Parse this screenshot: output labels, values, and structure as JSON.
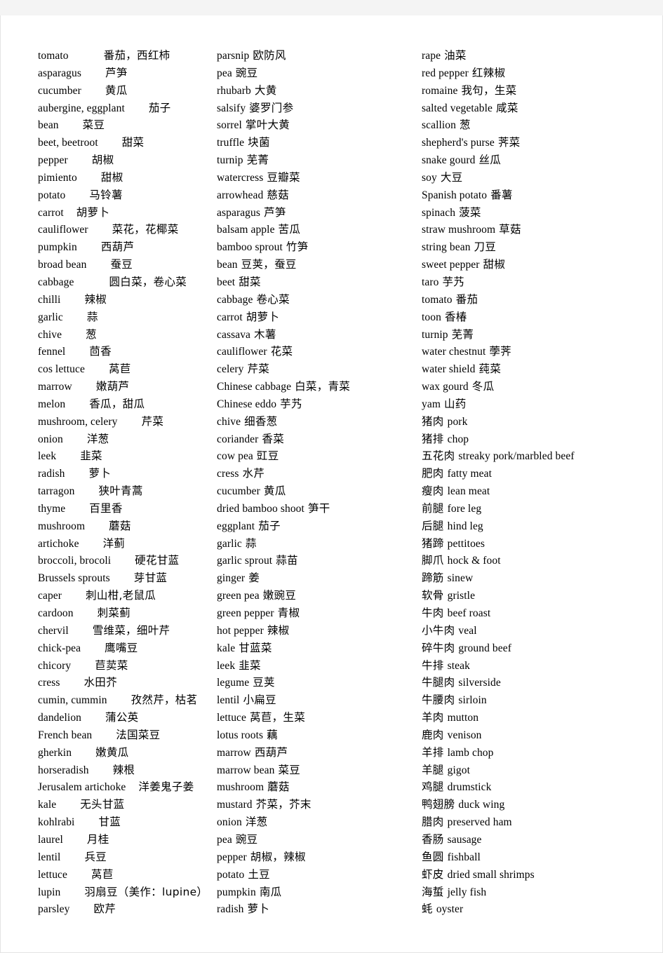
{
  "document": {
    "title": "English-Chinese Food Vocabulary List",
    "page_background": "#ffffff",
    "gutter_color": "#f4f4f4",
    "text_color": "#000000",
    "column_count": 3
  },
  "columns": [
    {
      "name": "column-1",
      "entries": [
        {
          "en": "tomato",
          "zh": "番茄，西红柿",
          "gap": "gap-l"
        },
        {
          "en": "asparagus",
          "zh": "芦笋",
          "gap": "gap-m"
        },
        {
          "en": "cucumber",
          "zh": "黄瓜",
          "gap": "gap-m"
        },
        {
          "en": "aubergine, eggplant",
          "zh": "茄子",
          "gap": "gap-m"
        },
        {
          "en": "bean",
          "zh": "菜豆",
          "gap": "gap-m"
        },
        {
          "en": "beet, beetroot",
          "zh": "甜菜",
          "gap": "gap-m"
        },
        {
          "en": "pepper",
          "zh": "胡椒",
          "gap": "gap-m"
        },
        {
          "en": "pimiento",
          "zh": "甜椒",
          "gap": "gap-m"
        },
        {
          "en": "potato",
          "zh": "马铃薯",
          "gap": "gap-m"
        },
        {
          "en": "carrot",
          "zh": "胡萝卜",
          "gap": "gap-s"
        },
        {
          "en": "cauliflower",
          "zh": "菜花，花椰菜",
          "gap": "gap-m"
        },
        {
          "en": "pumpkin",
          "zh": "西葫芦",
          "gap": "gap-m"
        },
        {
          "en": "broad bean",
          "zh": "蚕豆",
          "gap": "gap-m"
        },
        {
          "en": "cabbage",
          "zh": "圆白菜，卷心菜",
          "gap": "gap-l"
        },
        {
          "en": "chilli",
          "zh": "辣椒",
          "gap": "gap-m"
        },
        {
          "en": "garlic",
          "zh": "蒜",
          "gap": "gap-m"
        },
        {
          "en": "chive",
          "zh": "葱",
          "gap": "gap-m"
        },
        {
          "en": "fennel",
          "zh": "茴香",
          "gap": "gap-m"
        },
        {
          "en": "cos lettuce",
          "zh": "莴苣",
          "gap": "gap-m"
        },
        {
          "en": "marrow",
          "zh": "嫩葫芦",
          "gap": "gap-m"
        },
        {
          "en": "melon",
          "zh": "香瓜，甜瓜",
          "gap": "gap-m"
        },
        {
          "en": "mushroom, celery",
          "zh": "芹菜",
          "gap": "gap-m"
        },
        {
          "en": "onion",
          "zh": "洋葱",
          "gap": "gap-m"
        },
        {
          "en": "leek",
          "zh": "韭菜",
          "gap": "gap-m"
        },
        {
          "en": "radish",
          "zh": "萝卜",
          "gap": "gap-m"
        },
        {
          "en": "tarragon",
          "zh": "狭叶青蒿",
          "gap": "gap-m"
        },
        {
          "en": "thyme",
          "zh": "百里香",
          "gap": "gap-m"
        },
        {
          "en": "mushroom",
          "zh": "蘑菇",
          "gap": "gap-m"
        },
        {
          "en": "artichoke",
          "zh": "洋蓟",
          "gap": "gap-m"
        },
        {
          "en": "broccoli, brocoli",
          "zh": "硬花甘蓝",
          "gap": "gap-m"
        },
        {
          "en": "Brussels sprouts",
          "zh": "芽甘蓝",
          "gap": "gap-m"
        },
        {
          "en": "caper",
          "zh": "刺山柑,老鼠瓜",
          "gap": "gap-m"
        },
        {
          "en": "cardoon",
          "zh": "刺菜蓟",
          "gap": "gap-m"
        },
        {
          "en": "chervil",
          "zh": "雪维菜，细叶芹",
          "gap": "gap-m"
        },
        {
          "en": "chick-pea",
          "zh": "鹰嘴豆",
          "gap": "gap-m"
        },
        {
          "en": "chicory",
          "zh": "苣荬菜",
          "gap": "gap-m"
        },
        {
          "en": "cress",
          "zh": "水田芥",
          "gap": "gap-m"
        },
        {
          "en": "cumin, cummin",
          "zh": "孜然芹，枯茗",
          "gap": "gap-m"
        },
        {
          "en": "dandelion",
          "zh": "蒲公英",
          "gap": "gap-m"
        },
        {
          "en": "French bean",
          "zh": "法国菜豆",
          "gap": "gap-m"
        },
        {
          "en": "gherkin",
          "zh": "嫩黄瓜",
          "gap": "gap-m"
        },
        {
          "en": "horseradish",
          "zh": "辣根",
          "gap": "gap-m"
        },
        {
          "en": "Jerusalem artichoke",
          "zh": "洋姜鬼子姜",
          "gap": "gap-s"
        },
        {
          "en": "kale",
          "zh": "无头甘蓝",
          "gap": "gap-m"
        },
        {
          "en": "kohlrabi",
          "zh": "甘蓝",
          "gap": "gap-m"
        },
        {
          "en": "laurel",
          "zh": "月桂",
          "gap": "gap-m"
        },
        {
          "en": "lentil",
          "zh": "兵豆",
          "gap": "gap-m"
        },
        {
          "en": "lettuce",
          "zh": "莴苣",
          "gap": "gap-m"
        },
        {
          "en": "lupin",
          "zh": "羽扇豆（美作：lupine）",
          "gap": "gap-m"
        },
        {
          "en": "parsley",
          "zh": "欧芹",
          "gap": "gap-m"
        }
      ]
    },
    {
      "name": "column-2",
      "entries": [
        {
          "en": "parsnip",
          "zh": "欧防风",
          "gap": "gap-m"
        },
        {
          "en": "pea",
          "zh": "豌豆",
          "gap": "gap-m"
        },
        {
          "en": "rhubarb",
          "zh": "大黄",
          "gap": "gap-m"
        },
        {
          "en": "salsify",
          "zh": "婆罗门参",
          "gap": "gap-m"
        },
        {
          "en": "sorrel",
          "zh": "掌叶大黄",
          "gap": "gap-m"
        },
        {
          "en": "truffle",
          "zh": "块菌",
          "gap": "gap-m"
        },
        {
          "en": "turnip",
          "zh": "芜菁",
          "gap": "gap-m"
        },
        {
          "en": "watercress",
          "zh": "豆瓣菜",
          "gap": "gap-m"
        },
        {
          "en": "arrowhead",
          "zh": "慈菇",
          "gap": "gap-s"
        },
        {
          "en": "asparagus",
          "zh": "芦笋",
          "gap": "gap-s"
        },
        {
          "en": "balsam apple",
          "zh": "苦瓜",
          "gap": "gap-s"
        },
        {
          "en": "bamboo sprout",
          "zh": "竹笋",
          "gap": "gap-s"
        },
        {
          "en": "bean",
          "zh": "豆荚，蚕豆",
          "gap": "gap-s"
        },
        {
          "en": "beet",
          "zh": "甜菜",
          "gap": "gap-s"
        },
        {
          "en": "cabbage",
          "zh": "卷心菜",
          "gap": "gap-s"
        },
        {
          "en": "carrot",
          "zh": "胡萝卜",
          "gap": "gap-s"
        },
        {
          "en": "cassava",
          "zh": "木薯",
          "gap": "gap-s"
        },
        {
          "en": "cauliflower",
          "zh": "花菜",
          "gap": "gap-s"
        },
        {
          "en": "celery",
          "zh": "芹菜",
          "gap": "gap-s"
        },
        {
          "en": "Chinese cabbage",
          "zh": "白菜，青菜",
          "gap": "gap-s"
        },
        {
          "en": "Chinese eddo",
          "zh": "芋艿",
          "gap": "gap-s"
        },
        {
          "en": "chive",
          "zh": "细香葱",
          "gap": "gap-s"
        },
        {
          "en": "coriander",
          "zh": "香菜",
          "gap": "gap-s"
        },
        {
          "en": "cow pea",
          "zh": "豇豆",
          "gap": "gap-s"
        },
        {
          "en": "cress",
          "zh": "水芹",
          "gap": "gap-s"
        },
        {
          "en": "cucumber",
          "zh": "黄瓜",
          "gap": "gap-s"
        },
        {
          "en": "dried bamboo shoot",
          "zh": "笋干",
          "gap": "gap-s"
        },
        {
          "en": "eggplant",
          "zh": "茄子",
          "gap": "gap-s"
        },
        {
          "en": "garlic",
          "zh": "蒜",
          "gap": "gap-s"
        },
        {
          "en": "garlic sprout",
          "zh": "蒜苗",
          "gap": "gap-s"
        },
        {
          "en": "ginger",
          "zh": "姜",
          "gap": "gap-s"
        },
        {
          "en": "green pea",
          "zh": "嫩豌豆",
          "gap": "gap-s"
        },
        {
          "en": "green pepper",
          "zh": "青椒",
          "gap": "gap-s"
        },
        {
          "en": "hot pepper",
          "zh": "辣椒",
          "gap": "gap-s"
        },
        {
          "en": "kale",
          "zh": "甘蓝菜",
          "gap": "gap-s"
        },
        {
          "en": "leek",
          "zh": "韭菜",
          "gap": "gap-s"
        },
        {
          "en": "legume",
          "zh": "豆荚",
          "gap": "gap-s"
        },
        {
          "en": "lentil",
          "zh": "小扁豆",
          "gap": "gap-s"
        },
        {
          "en": "lettuce",
          "zh": "莴苣，生菜",
          "gap": "gap-s"
        },
        {
          "en": "lotus roots",
          "zh": "藕",
          "gap": "gap-s"
        },
        {
          "en": "marrow",
          "zh": "西葫芦",
          "gap": "gap-s"
        },
        {
          "en": "marrow bean",
          "zh": "菜豆",
          "gap": "gap-s"
        },
        {
          "en": "mushroom",
          "zh": "蘑菇",
          "gap": "gap-s"
        },
        {
          "en": "mustard",
          "zh": "芥菜，芥末",
          "gap": "gap-s"
        },
        {
          "en": "onion",
          "zh": "洋葱",
          "gap": "gap-s"
        },
        {
          "en": "pea",
          "zh": "豌豆",
          "gap": "gap-s"
        },
        {
          "en": "pepper",
          "zh": "胡椒，辣椒",
          "gap": "gap-s"
        },
        {
          "en": "potato",
          "zh": "土豆",
          "gap": "gap-s"
        },
        {
          "en": "pumpkin",
          "zh": "南瓜",
          "gap": "gap-s"
        },
        {
          "en": "radish",
          "zh": "萝卜",
          "gap": "gap-s"
        }
      ]
    },
    {
      "name": "column-3",
      "entries": [
        {
          "en": "rape",
          "zh": "油菜",
          "gap": "gap-s",
          "order": "en-first"
        },
        {
          "en": "red pepper",
          "zh": "红辣椒",
          "gap": "gap-s",
          "order": "en-first"
        },
        {
          "en": "romaine",
          "zh": "我句，生菜",
          "gap": "gap-s",
          "order": "en-first"
        },
        {
          "en": "salted vegetable",
          "zh": "咸菜",
          "gap": "gap-s",
          "order": "en-first"
        },
        {
          "en": "scallion",
          "zh": "葱",
          "gap": "gap-s",
          "order": "en-first"
        },
        {
          "en": "shepherd's purse",
          "zh": "荠菜",
          "gap": "gap-s",
          "order": "en-first"
        },
        {
          "en": "snake gourd",
          "zh": "丝瓜",
          "gap": "gap-s",
          "order": "en-first"
        },
        {
          "en": "soy",
          "zh": "大豆",
          "gap": "gap-s",
          "order": "en-first"
        },
        {
          "en": "Spanish potato",
          "zh": "番薯",
          "gap": "gap-s",
          "order": "en-first"
        },
        {
          "en": "spinach",
          "zh": "菠菜",
          "gap": "gap-s",
          "order": "en-first"
        },
        {
          "en": "straw mushroom",
          "zh": "草菇",
          "gap": "gap-s",
          "order": "en-first"
        },
        {
          "en": "string bean",
          "zh": "刀豆",
          "gap": "gap-s",
          "order": "en-first"
        },
        {
          "en": "sweet pepper",
          "zh": "甜椒",
          "gap": "gap-s",
          "order": "en-first"
        },
        {
          "en": "taro",
          "zh": "芋艿",
          "gap": "gap-s",
          "order": "en-first"
        },
        {
          "en": "tomato",
          "zh": "番茄",
          "gap": "gap-s",
          "order": "en-first"
        },
        {
          "en": "toon",
          "zh": "香椿",
          "gap": "gap-s",
          "order": "en-first"
        },
        {
          "en": "turnip",
          "zh": "芜菁",
          "gap": "gap-s",
          "order": "en-first"
        },
        {
          "en": "water chestnut",
          "zh": "荸荠",
          "gap": "gap-s",
          "order": "en-first"
        },
        {
          "en": "water shield",
          "zh": "莼菜",
          "gap": "gap-s",
          "order": "en-first"
        },
        {
          "en": "wax gourd",
          "zh": "冬瓜",
          "gap": "gap-s",
          "order": "en-first"
        },
        {
          "en": "yam",
          "zh": "山药",
          "gap": "gap-s",
          "order": "en-first"
        },
        {
          "en": "pork",
          "zh": "猪肉",
          "gap": "gap-s",
          "order": "zh-first"
        },
        {
          "en": "chop",
          "zh": "猪排",
          "gap": "gap-s",
          "order": "zh-first"
        },
        {
          "en": "streaky pork/marbled beef",
          "zh": "五花肉",
          "gap": "gap-s",
          "order": "zh-first"
        },
        {
          "en": "fatty meat",
          "zh": "肥肉",
          "gap": "gap-s",
          "order": "zh-first"
        },
        {
          "en": "lean meat",
          "zh": "瘦肉",
          "gap": "gap-s",
          "order": "zh-first"
        },
        {
          "en": "fore leg",
          "zh": "前腿",
          "gap": "gap-s",
          "order": "zh-first"
        },
        {
          "en": "hind leg",
          "zh": "后腿",
          "gap": "gap-s",
          "order": "zh-first"
        },
        {
          "en": "pettitoes",
          "zh": "猪蹄",
          "gap": "gap-s",
          "order": "zh-first"
        },
        {
          "en": "hock & foot",
          "zh": "脚爪",
          "gap": "gap-s",
          "order": "zh-first"
        },
        {
          "en": "sinew",
          "zh": "蹄筋",
          "gap": "gap-s",
          "order": "zh-first"
        },
        {
          "en": "gristle",
          "zh": "软骨",
          "gap": "gap-s",
          "order": "zh-first"
        },
        {
          "en": "beef roast",
          "zh": "牛肉",
          "gap": "gap-s",
          "order": "zh-first"
        },
        {
          "en": "veal",
          "zh": "小牛肉",
          "gap": "gap-s",
          "order": "zh-first"
        },
        {
          "en": "ground beef",
          "zh": "碎牛肉",
          "gap": "gap-s",
          "order": "zh-first"
        },
        {
          "en": "steak",
          "zh": "牛排",
          "gap": "gap-s",
          "order": "zh-first"
        },
        {
          "en": "silverside",
          "zh": "牛腿肉",
          "gap": "gap-s",
          "order": "zh-first"
        },
        {
          "en": "sirloin",
          "zh": "牛腰肉",
          "gap": "gap-s",
          "order": "zh-first"
        },
        {
          "en": "mutton",
          "zh": "羊肉",
          "gap": "gap-s",
          "order": "zh-first"
        },
        {
          "en": "venison",
          "zh": "鹿肉",
          "gap": "gap-s",
          "order": "zh-first"
        },
        {
          "en": "lamb chop",
          "zh": "羊排",
          "gap": "gap-s",
          "order": "zh-first"
        },
        {
          "en": "gigot",
          "zh": "羊腿",
          "gap": "gap-s",
          "order": "zh-first"
        },
        {
          "en": "drumstick",
          "zh": "鸡腿",
          "gap": "gap-s",
          "order": "zh-first"
        },
        {
          "en": "duck wing",
          "zh": "鸭翅膀",
          "gap": "gap-s",
          "order": "zh-first"
        },
        {
          "en": "preserved ham",
          "zh": "腊肉",
          "gap": "gap-s",
          "order": "zh-first"
        },
        {
          "en": "sausage",
          "zh": "香肠",
          "gap": "gap-s",
          "order": "zh-first"
        },
        {
          "en": "fishball",
          "zh": "鱼圆",
          "gap": "gap-s",
          "order": "zh-first"
        },
        {
          "en": "dried small shrimps",
          "zh": "虾皮",
          "gap": "gap-s",
          "order": "zh-first"
        },
        {
          "en": "jelly fish",
          "zh": "海蜇",
          "gap": "gap-s",
          "order": "zh-first"
        },
        {
          "en": "oyster",
          "zh": "蚝",
          "gap": "gap-s",
          "order": "zh-first"
        }
      ]
    }
  ]
}
